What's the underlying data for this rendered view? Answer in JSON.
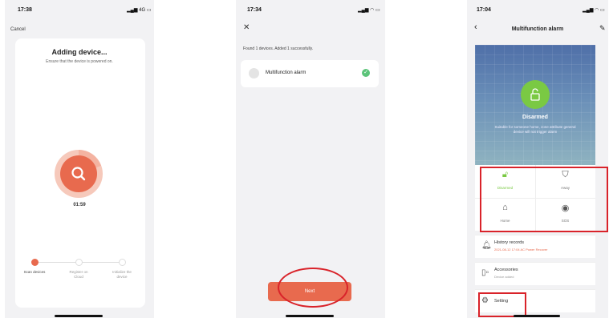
{
  "screen1": {
    "time": "17:38",
    "signal": "4G",
    "cancel": "Cancel",
    "title": "Adding device...",
    "subtitle": "Ensure that the device is powered on.",
    "timer": "01:59",
    "steps": [
      {
        "label": "Scan devices",
        "state": "active"
      },
      {
        "label": "Register on Cloud",
        "state": "pending"
      },
      {
        "label": "Initialize the device",
        "state": "pending"
      }
    ]
  },
  "screen2": {
    "time": "17:34",
    "close_icon": "close-icon",
    "found_text": "Found 1 devices. Added 1 successfully.",
    "device_name": "Multifunction alarm",
    "next": "Next"
  },
  "screen3": {
    "time": "17:04",
    "title": "Multifunction alarm",
    "status": "Disarmed",
    "status_desc": "Suitable for someone home, zone attribute general device will not trigger alarm",
    "modes": [
      {
        "label": "Disarmed",
        "icon": "lock-open-icon",
        "active": true
      },
      {
        "label": "Away",
        "icon": "shield-icon",
        "active": false
      },
      {
        "label": "Home",
        "icon": "home-icon",
        "active": false
      },
      {
        "label": "SOS",
        "icon": "sos-icon",
        "active": false
      }
    ],
    "history": {
      "title": "History records",
      "detail": "2021-08-12 17:04 AC Power Recover"
    },
    "accessories": {
      "title": "Accessories",
      "detail": "Device added"
    },
    "setting": "Setting"
  },
  "colors": {
    "accent": "#e86a4e",
    "green": "#7ac943",
    "annotation_red": "#d9232a"
  }
}
